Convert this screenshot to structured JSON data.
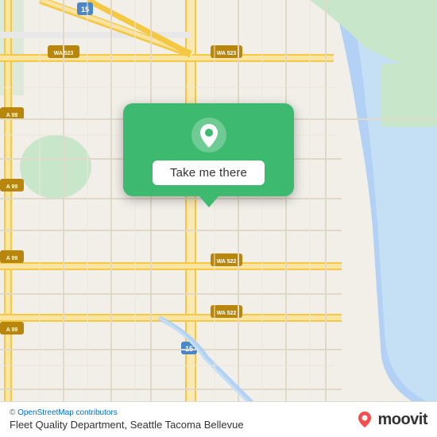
{
  "map": {
    "background_color": "#f2efe9",
    "water_color": "#b3d1f5",
    "road_color_primary": "#f5c842",
    "road_color_secondary": "#ffffff",
    "green_area_color": "#c8e6c9"
  },
  "popup": {
    "background_color": "#3dba6f",
    "button_label": "Take me there",
    "pin_icon": "location-pin-icon"
  },
  "bottom_bar": {
    "osm_credit": "© OpenStreetMap contributors",
    "location_name": "Fleet Quality Department, Seattle Tacoma Bellevue",
    "moovit_brand": "moovit"
  },
  "route_labels": {
    "i5": "15",
    "wa99_1": "A 99",
    "wa99_2": "A 99",
    "wa99_3": "A 99",
    "wa99_4": "A 99",
    "wa522_1": "WA 522",
    "wa522_2": "WA 522",
    "wa523_1": "WA 523",
    "wa523_2": "WA 523",
    "i5_top": "15",
    "i5_mid": "15",
    "i5_bot": "15"
  }
}
